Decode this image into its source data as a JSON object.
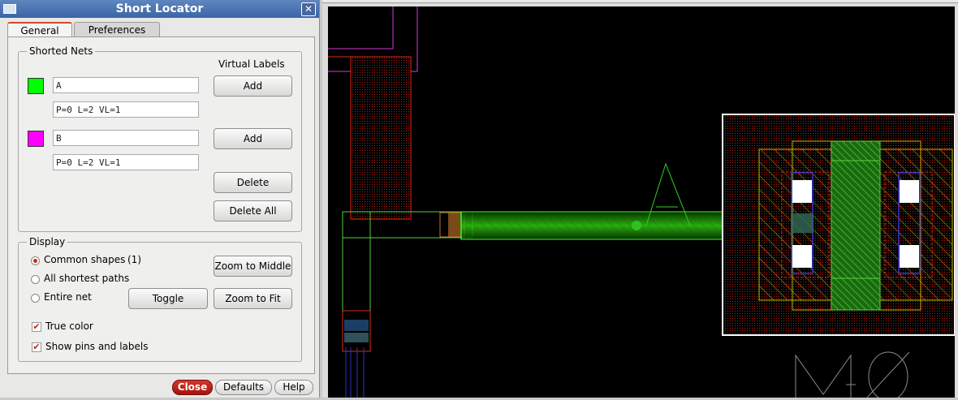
{
  "dialog": {
    "title": "Short Locator",
    "close_glyph": "✕",
    "tabs": [
      {
        "label": "General"
      },
      {
        "label": "Preferences"
      }
    ]
  },
  "shorted_nets": {
    "legend": "Shorted Nets",
    "virtual_labels_heading": "Virtual Labels",
    "nets": [
      {
        "name": "A",
        "stats": "P=0 L=2 VL=1",
        "color": "#00ff00",
        "add_label": "Add"
      },
      {
        "name": "B",
        "stats": "P=0 L=2 VL=1",
        "color": "#ff00ff",
        "add_label": "Add"
      }
    ],
    "delete_label": "Delete",
    "delete_all_label": "Delete All"
  },
  "display": {
    "legend": "Display",
    "options": [
      {
        "label": "Common shapes",
        "count": "(1)",
        "selected": true
      },
      {
        "label": "All shortest paths",
        "selected": false
      },
      {
        "label": "Entire net",
        "selected": false
      }
    ],
    "zoom_middle_label": "Zoom to Middle",
    "toggle_label": "Toggle",
    "zoom_fit_label": "Zoom to Fit",
    "checks": [
      {
        "label": "True color",
        "checked": true
      },
      {
        "label": "Show pins and labels",
        "checked": true
      }
    ],
    "check_mark": "✔"
  },
  "footer": {
    "close": "Close",
    "defaults": "Defaults",
    "help": "Help"
  },
  "canvas": {
    "net_label": "A",
    "layer_text": "M0"
  }
}
